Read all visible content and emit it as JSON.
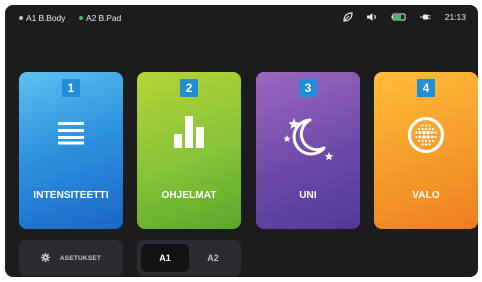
{
  "status_bar": {
    "devices": [
      {
        "label": "A1 B.Body",
        "color": "#bdbdbd"
      },
      {
        "label": "A2 B.Pad",
        "color": "#3bc15f"
      }
    ],
    "icons": [
      "leaf-icon",
      "volume-icon",
      "battery-icon",
      "plug-icon"
    ],
    "time": "21:13"
  },
  "tiles": [
    {
      "number": "1",
      "label": "INTENSITEETTI",
      "icon": "intensity-lines-icon"
    },
    {
      "number": "2",
      "label": "OHJELMAT",
      "icon": "bar-chart-icon"
    },
    {
      "number": "3",
      "label": "UNI",
      "icon": "moon-stars-icon"
    },
    {
      "number": "4",
      "label": "VALO",
      "icon": "light-dots-icon"
    }
  ],
  "bottom": {
    "settings_label": "ASETUKSET",
    "segment": {
      "options": [
        "A1",
        "A2"
      ],
      "selected": "A1"
    }
  }
}
